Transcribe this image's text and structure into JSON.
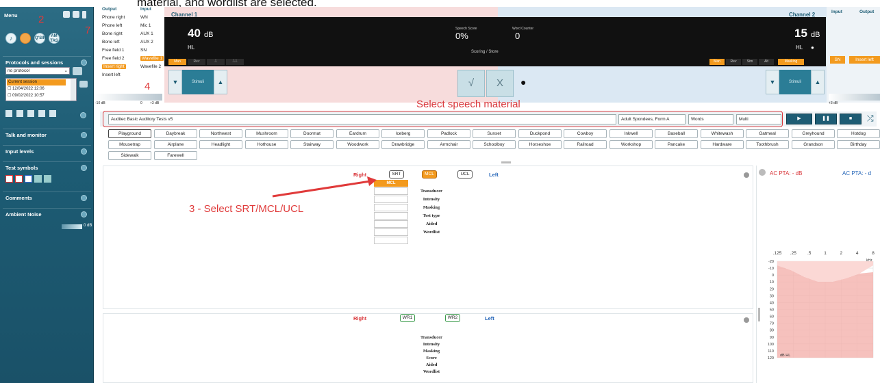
{
  "caption": "material, and wordlist are selected.",
  "sidebar": {
    "menu_label": "Menu",
    "icons": [
      "note-icon",
      "settings-icon",
      "qsin-icon",
      "amtas-icon"
    ],
    "icon_text": {
      "qsin": "Q'SIN",
      "amtas": "AM TAS"
    },
    "sections": {
      "protocols": "Protocols and sessions",
      "talk": "Talk and monitor",
      "input_levels": "Input levels",
      "test_symbols": "Test symbols",
      "comments": "Comments",
      "ambient_noise": "Ambient Noise"
    },
    "protocol_value": "no protocol",
    "sessions": [
      "Current session",
      "12/04/2022 12:06",
      "09/02/2022 10:57"
    ],
    "ambient_level": "0 dB"
  },
  "annotations": {
    "num2": "2",
    "num7": "7",
    "num4": "4",
    "select_speech": "Select speech material",
    "select_srt": "3 - Select SRT/MCL/UCL"
  },
  "routing": {
    "output_header": "Output",
    "input_header": "Input",
    "outputs": [
      "Phone right",
      "Phone left",
      "Bone right",
      "Bone left",
      "Free field 1",
      "Free field 2",
      "Insert right",
      "Insert left"
    ],
    "inputs": [
      "WN",
      "Mic 1",
      "AUX 1",
      "AUX 2",
      "SN",
      "Wavefile 1",
      "Wavefile 2"
    ],
    "slider_left": "-10 dB",
    "slider_mid": "0",
    "slider_right": "+3 dB"
  },
  "channel1": {
    "title": "Channel 1",
    "level": "40",
    "unit": "dB",
    "hl": "HL",
    "buttons": [
      "Man",
      "Rev",
      "⎍",
      "⎍⎍"
    ],
    "stimuli": "Stimuli"
  },
  "center": {
    "speech_score_label": "Speech Score",
    "speech_score": "0%",
    "word_counter_label": "Word Counter",
    "word_counter": "0",
    "scoring": "Scoring  /  Store",
    "check": "√",
    "cross": "X",
    "dot": "●"
  },
  "channel2": {
    "title": "Channel 2",
    "level": "15",
    "unit": "dB",
    "hl": "HL",
    "buttons": [
      "Man",
      "Rev",
      "Sim",
      "Alt",
      "Masking"
    ],
    "stimuli": "Stimuli",
    "slider_right": "+3 dB"
  },
  "right_routing": {
    "input_header": "Input",
    "output_header": "Output",
    "input_sel": "SN",
    "output_sel": "Insert left"
  },
  "speech_material": {
    "test": "Auditec Basic Auditory Tests v5",
    "list": "Adult Spondees, Form A",
    "type": "Words",
    "mode": "Multi",
    "play": "▶",
    "pause": "❚❚",
    "stop": "■",
    "shuffle": "⤮"
  },
  "words": [
    "Playground",
    "Daybreak",
    "Northwest",
    "Mushroom",
    "Doormat",
    "Eardrum",
    "Iceberg",
    "Padlock",
    "Sunset",
    "Duckpond",
    "Cowboy",
    "Inkwell",
    "Baseball",
    "Whitewash",
    "Oatmeal",
    "Greyhound",
    "Hotdog",
    "Mousetrap",
    "Airplane",
    "Headlight",
    "Hothouse",
    "Stairway",
    "Woodwork",
    "Drawbridge",
    "Armchair",
    "Schoolboy",
    "Horseshoe",
    "Railroad",
    "Workshop",
    "Pancake",
    "Hardware",
    "Toothbrush",
    "Grandson",
    "Birthday",
    "Sidewalk",
    "Farewell"
  ],
  "panel_top": {
    "right": "Right",
    "left": "Left",
    "tabs": [
      "SRT",
      "MCL",
      "UCL"
    ],
    "col_header": "MCL",
    "rows": [
      "Transducer",
      "Intensity",
      "Masking",
      "Test type",
      "Aided",
      "Wordlist"
    ]
  },
  "panel_bottom": {
    "right": "Right",
    "left": "Left",
    "tabs": [
      "WR1",
      "WR2"
    ],
    "rows": [
      "Transducer",
      "Intensity",
      "Masking",
      "Score",
      "Aided",
      "Wordlist"
    ]
  },
  "audiogram": {
    "pta_left": "AC PTA:  - dB",
    "pta_right": "AC PTA:  - d",
    "freqs": [
      ".125",
      ".25",
      ".5",
      "1",
      "2",
      "4",
      "8"
    ],
    "freq_unit": "kHz",
    "levels": [
      "-20",
      "-10",
      "0",
      "10",
      "20",
      "30",
      "40",
      "50",
      "60",
      "70",
      "80",
      "90",
      "100",
      "110",
      "120"
    ],
    "unit": "dB HL"
  }
}
